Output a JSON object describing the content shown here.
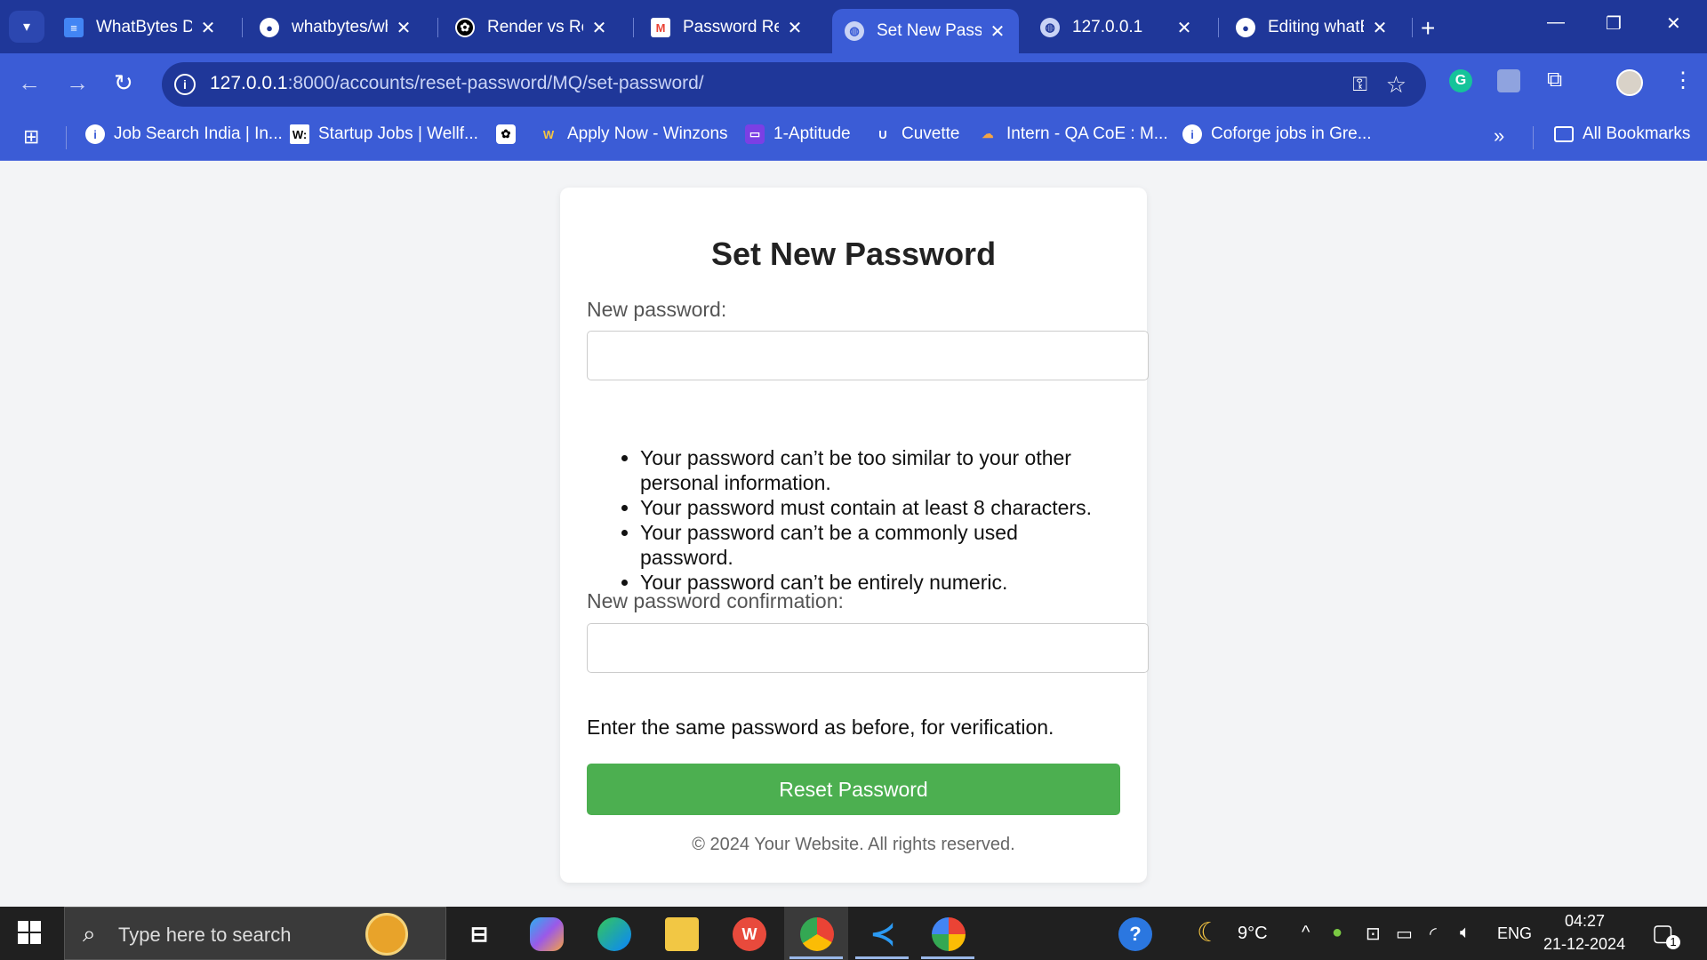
{
  "tabs": [
    {
      "title": "WhatBytes Dj",
      "icon": "docs-icon",
      "color": "#4285f4"
    },
    {
      "title": "whatbytes/wh",
      "icon": "github-icon",
      "color": "#ffffff"
    },
    {
      "title": "Render vs Red",
      "icon": "openai-icon",
      "color": "#ffffff"
    },
    {
      "title": "Password Res",
      "icon": "gmail-icon",
      "color": "#ea4335"
    },
    {
      "title": "Set New Passw",
      "icon": "globe-icon",
      "color": "#c9d3f5"
    },
    {
      "title": "127.0.0.1",
      "icon": "globe-icon",
      "color": "#c9d3f5"
    },
    {
      "title": "Editing whatB",
      "icon": "github-icon",
      "color": "#ffffff"
    }
  ],
  "address": {
    "host": "127.0.0.1",
    "path": ":8000/accounts/reset-password/MQ/set-password/"
  },
  "bookmarks": [
    {
      "label": "Job Search India | In...",
      "icon": "info-icon"
    },
    {
      "label": "Startup Jobs | Wellf...",
      "icon": "wellfound-icon",
      "glyph": "W:"
    },
    {
      "label": "",
      "icon": "openai-icon"
    },
    {
      "label": "Apply Now - Winzons",
      "icon": "winzons-icon"
    },
    {
      "label": "1-Aptitude",
      "icon": "aptitude-icon"
    },
    {
      "label": "Cuvette",
      "icon": "cuvette-icon"
    },
    {
      "label": "Intern - QA CoE : M...",
      "icon": "cloud-icon"
    },
    {
      "label": "Coforge jobs in Gre...",
      "icon": "info-icon"
    }
  ],
  "all_bookmarks": "All Bookmarks",
  "form": {
    "title": "Set New Password",
    "password_label": "New password:",
    "rules": [
      "Your password can’t be too similar to your other personal information.",
      "Your password must contain at least 8 characters.",
      "Your password can’t be a commonly used password.",
      "Your password can’t be entirely numeric."
    ],
    "confirm_label": "New password confirmation:",
    "confirm_help": "Enter the same password as before, for verification.",
    "submit_label": "Reset Password",
    "footer": "© 2024 Your Website. All rights reserved.",
    "accent": "#4caf50"
  },
  "taskbar": {
    "search_placeholder": "Type here to search",
    "weather": "9°C",
    "language": "ENG",
    "time": "04:27",
    "date": "21-12-2024",
    "notification_count": "1"
  }
}
